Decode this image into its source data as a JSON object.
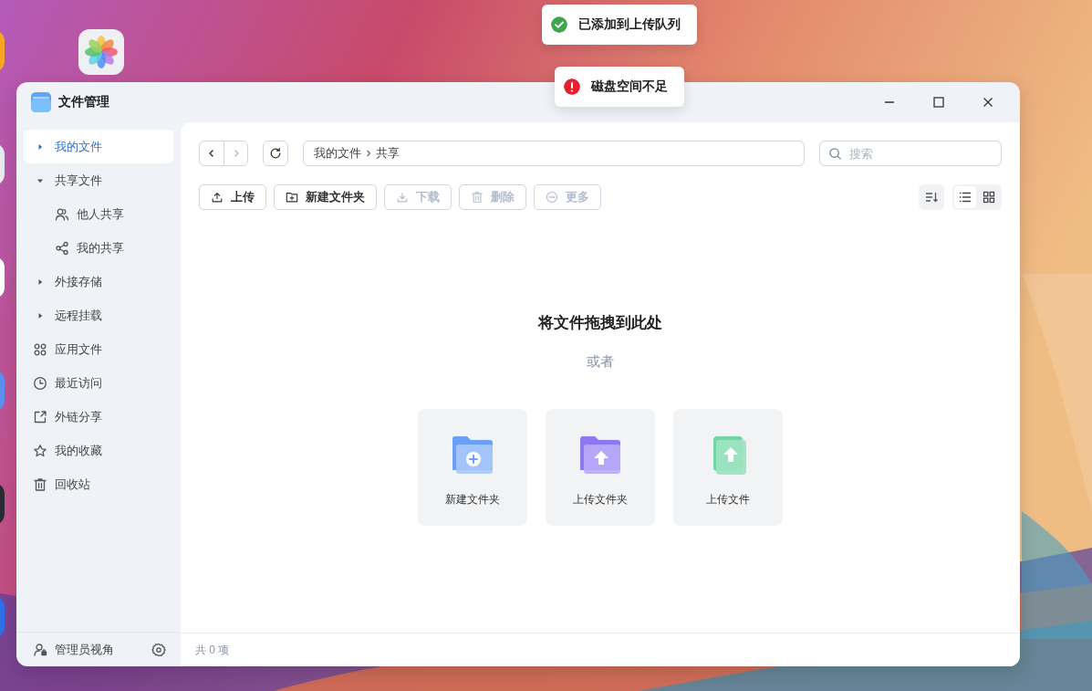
{
  "window": {
    "title": "文件管理"
  },
  "toasts": [
    {
      "kind": "success",
      "text": "已添加到上传队列"
    },
    {
      "kind": "error",
      "text": "磁盘空间不足"
    }
  ],
  "sidebar": {
    "items": [
      {
        "kind": "folder",
        "label": "我的文件",
        "expanded": false,
        "selected": true
      },
      {
        "kind": "folder",
        "label": "共享文件",
        "expanded": true,
        "selected": false,
        "children": [
          {
            "label": "他人共享",
            "selected": false
          },
          {
            "label": "我的共享",
            "selected": false
          }
        ]
      },
      {
        "kind": "folder",
        "label": "外接存储",
        "expanded": false,
        "selected": false
      },
      {
        "kind": "folder",
        "label": "远程挂载",
        "expanded": false,
        "selected": false
      },
      {
        "kind": "nav",
        "label": "应用文件",
        "selected": false
      },
      {
        "kind": "nav",
        "label": "最近访问",
        "selected": false
      },
      {
        "kind": "nav",
        "label": "外链分享",
        "selected": false
      },
      {
        "kind": "nav",
        "label": "我的收藏",
        "selected": false
      },
      {
        "kind": "nav",
        "label": "回收站",
        "selected": false
      }
    ],
    "footer": {
      "label": "管理员视角"
    }
  },
  "navigation": {
    "back_disabled": false,
    "forward_disabled": true
  },
  "breadcrumb": [
    "我的文件",
    "共享"
  ],
  "search": {
    "placeholder": "搜索"
  },
  "toolbar": [
    {
      "label": "上传",
      "disabled": false
    },
    {
      "label": "新建文件夹",
      "disabled": false
    },
    {
      "label": "下载",
      "disabled": true
    },
    {
      "label": "删除",
      "disabled": true
    },
    {
      "label": "更多",
      "disabled": true
    }
  ],
  "view_modes": [
    {
      "kind": "list",
      "selected": true
    },
    {
      "kind": "grid",
      "selected": false
    }
  ],
  "empty_state": {
    "title": "将文件拖拽到此处",
    "subtitle": "或者",
    "actions": [
      {
        "kind": "new-folder",
        "label": "新建文件夹"
      },
      {
        "kind": "upload-folder",
        "label": "上传文件夹"
      },
      {
        "kind": "upload-file",
        "label": "上传文件"
      }
    ]
  },
  "status_bar": {
    "count": "共 0 项"
  }
}
